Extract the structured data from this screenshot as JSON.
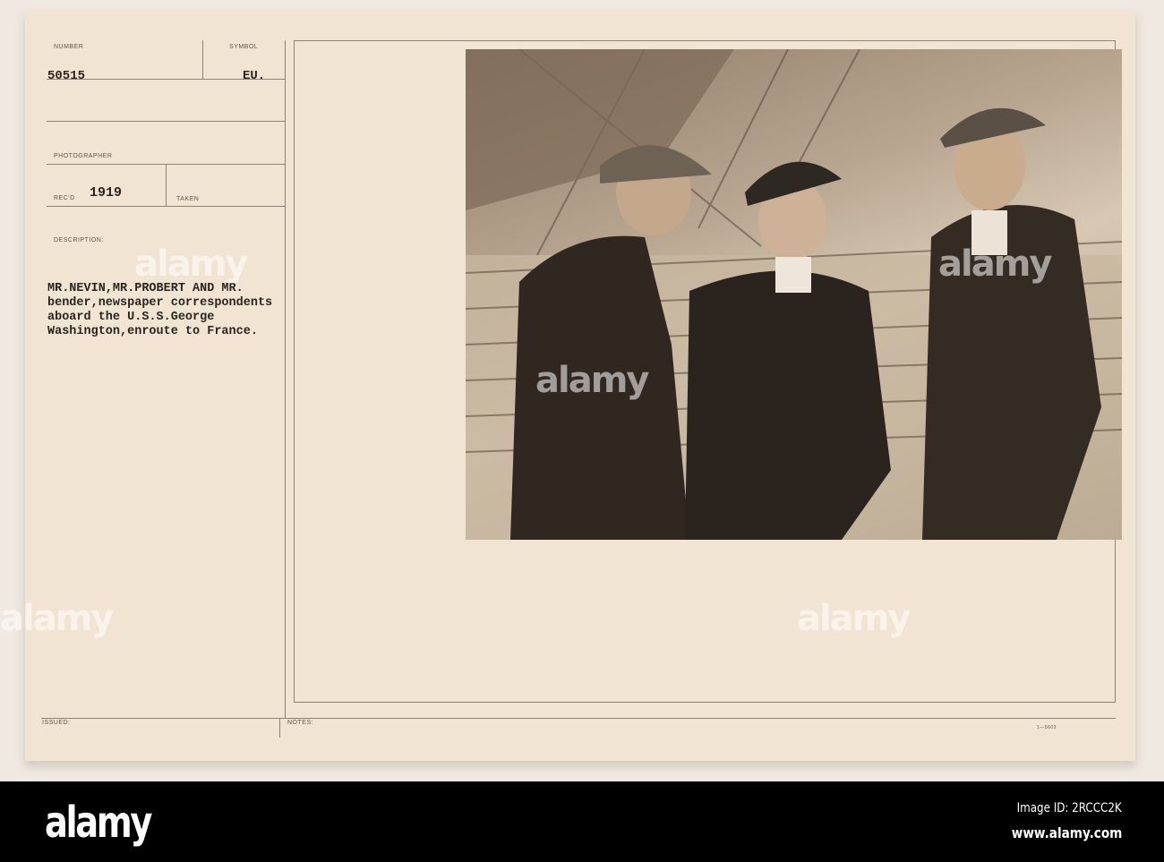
{
  "card": {
    "number_label": "NUMBER",
    "number": "50515",
    "symbol_label": "SYMBOL",
    "symbol": "EU.",
    "photographer_label": "PHOTOGRAPHER",
    "recd_label": "REC'D",
    "recd_year": "1919",
    "taken_label": "TAKEN",
    "description_label": "DESCRIPTION:",
    "description": "MR.NEVIN,MR.PROBERT AND MR.\nbender,newspaper correspondents\naboard the U.S.S.George\nWashington,enroute to France.",
    "issued_label": "ISSUED:",
    "notes_label": "NOTES:",
    "form_code": "1—5603"
  },
  "watermark": "alamy",
  "footer": {
    "logo": "alamy",
    "image_id": "Image ID: 2RCCC2K",
    "url": "www.alamy.com"
  }
}
